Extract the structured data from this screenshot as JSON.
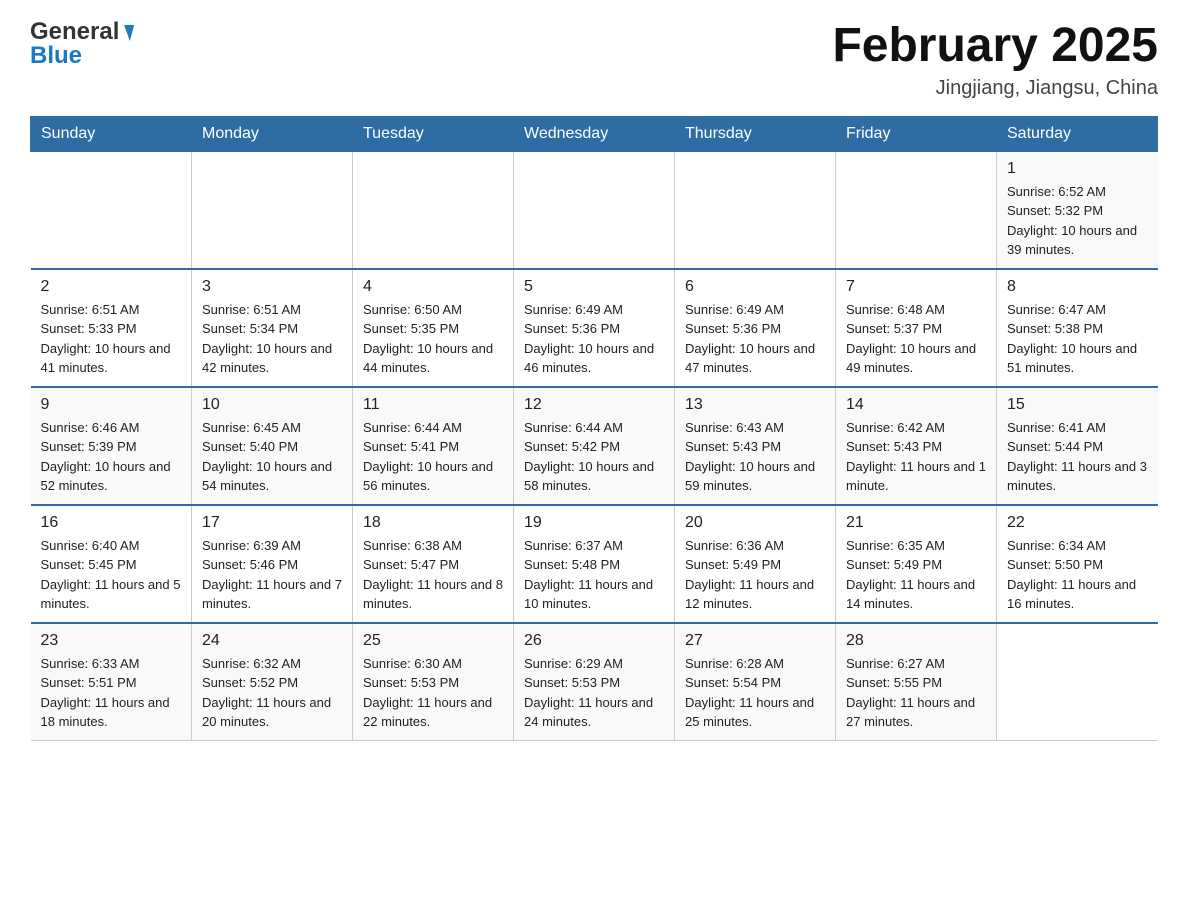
{
  "header": {
    "logo_general": "General",
    "logo_blue": "Blue",
    "month_title": "February 2025",
    "location": "Jingjiang, Jiangsu, China"
  },
  "days_of_week": [
    "Sunday",
    "Monday",
    "Tuesday",
    "Wednesday",
    "Thursday",
    "Friday",
    "Saturday"
  ],
  "weeks": [
    {
      "days": [
        {
          "number": "",
          "info": ""
        },
        {
          "number": "",
          "info": ""
        },
        {
          "number": "",
          "info": ""
        },
        {
          "number": "",
          "info": ""
        },
        {
          "number": "",
          "info": ""
        },
        {
          "number": "",
          "info": ""
        },
        {
          "number": "1",
          "info": "Sunrise: 6:52 AM\nSunset: 5:32 PM\nDaylight: 10 hours and 39 minutes."
        }
      ]
    },
    {
      "days": [
        {
          "number": "2",
          "info": "Sunrise: 6:51 AM\nSunset: 5:33 PM\nDaylight: 10 hours and 41 minutes."
        },
        {
          "number": "3",
          "info": "Sunrise: 6:51 AM\nSunset: 5:34 PM\nDaylight: 10 hours and 42 minutes."
        },
        {
          "number": "4",
          "info": "Sunrise: 6:50 AM\nSunset: 5:35 PM\nDaylight: 10 hours and 44 minutes."
        },
        {
          "number": "5",
          "info": "Sunrise: 6:49 AM\nSunset: 5:36 PM\nDaylight: 10 hours and 46 minutes."
        },
        {
          "number": "6",
          "info": "Sunrise: 6:49 AM\nSunset: 5:36 PM\nDaylight: 10 hours and 47 minutes."
        },
        {
          "number": "7",
          "info": "Sunrise: 6:48 AM\nSunset: 5:37 PM\nDaylight: 10 hours and 49 minutes."
        },
        {
          "number": "8",
          "info": "Sunrise: 6:47 AM\nSunset: 5:38 PM\nDaylight: 10 hours and 51 minutes."
        }
      ]
    },
    {
      "days": [
        {
          "number": "9",
          "info": "Sunrise: 6:46 AM\nSunset: 5:39 PM\nDaylight: 10 hours and 52 minutes."
        },
        {
          "number": "10",
          "info": "Sunrise: 6:45 AM\nSunset: 5:40 PM\nDaylight: 10 hours and 54 minutes."
        },
        {
          "number": "11",
          "info": "Sunrise: 6:44 AM\nSunset: 5:41 PM\nDaylight: 10 hours and 56 minutes."
        },
        {
          "number": "12",
          "info": "Sunrise: 6:44 AM\nSunset: 5:42 PM\nDaylight: 10 hours and 58 minutes."
        },
        {
          "number": "13",
          "info": "Sunrise: 6:43 AM\nSunset: 5:43 PM\nDaylight: 10 hours and 59 minutes."
        },
        {
          "number": "14",
          "info": "Sunrise: 6:42 AM\nSunset: 5:43 PM\nDaylight: 11 hours and 1 minute."
        },
        {
          "number": "15",
          "info": "Sunrise: 6:41 AM\nSunset: 5:44 PM\nDaylight: 11 hours and 3 minutes."
        }
      ]
    },
    {
      "days": [
        {
          "number": "16",
          "info": "Sunrise: 6:40 AM\nSunset: 5:45 PM\nDaylight: 11 hours and 5 minutes."
        },
        {
          "number": "17",
          "info": "Sunrise: 6:39 AM\nSunset: 5:46 PM\nDaylight: 11 hours and 7 minutes."
        },
        {
          "number": "18",
          "info": "Sunrise: 6:38 AM\nSunset: 5:47 PM\nDaylight: 11 hours and 8 minutes."
        },
        {
          "number": "19",
          "info": "Sunrise: 6:37 AM\nSunset: 5:48 PM\nDaylight: 11 hours and 10 minutes."
        },
        {
          "number": "20",
          "info": "Sunrise: 6:36 AM\nSunset: 5:49 PM\nDaylight: 11 hours and 12 minutes."
        },
        {
          "number": "21",
          "info": "Sunrise: 6:35 AM\nSunset: 5:49 PM\nDaylight: 11 hours and 14 minutes."
        },
        {
          "number": "22",
          "info": "Sunrise: 6:34 AM\nSunset: 5:50 PM\nDaylight: 11 hours and 16 minutes."
        }
      ]
    },
    {
      "days": [
        {
          "number": "23",
          "info": "Sunrise: 6:33 AM\nSunset: 5:51 PM\nDaylight: 11 hours and 18 minutes."
        },
        {
          "number": "24",
          "info": "Sunrise: 6:32 AM\nSunset: 5:52 PM\nDaylight: 11 hours and 20 minutes."
        },
        {
          "number": "25",
          "info": "Sunrise: 6:30 AM\nSunset: 5:53 PM\nDaylight: 11 hours and 22 minutes."
        },
        {
          "number": "26",
          "info": "Sunrise: 6:29 AM\nSunset: 5:53 PM\nDaylight: 11 hours and 24 minutes."
        },
        {
          "number": "27",
          "info": "Sunrise: 6:28 AM\nSunset: 5:54 PM\nDaylight: 11 hours and 25 minutes."
        },
        {
          "number": "28",
          "info": "Sunrise: 6:27 AM\nSunset: 5:55 PM\nDaylight: 11 hours and 27 minutes."
        },
        {
          "number": "",
          "info": ""
        }
      ]
    }
  ]
}
